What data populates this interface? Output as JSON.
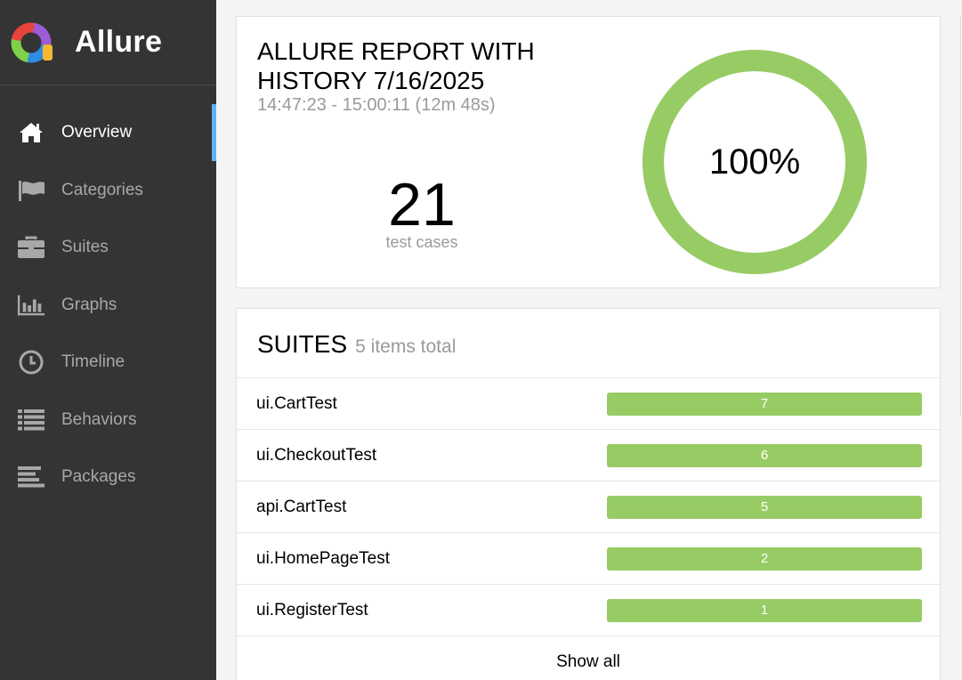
{
  "app": {
    "name": "Allure",
    "logo_icon": "allure-logo-icon"
  },
  "sidebar": {
    "items": [
      {
        "label": "Overview",
        "icon": "home-icon",
        "active": true
      },
      {
        "label": "Categories",
        "icon": "flag-icon",
        "active": false
      },
      {
        "label": "Suites",
        "icon": "briefcase-icon",
        "active": false
      },
      {
        "label": "Graphs",
        "icon": "bar-chart-icon",
        "active": false
      },
      {
        "label": "Timeline",
        "icon": "clock-icon",
        "active": false
      },
      {
        "label": "Behaviors",
        "icon": "list-icon",
        "active": false
      },
      {
        "label": "Packages",
        "icon": "align-left-icon",
        "active": false
      }
    ]
  },
  "summary": {
    "title": "ALLURE REPORT WITH HISTORY 7/16/2025",
    "time_range": "14:47:23 - 15:00:11 (12m 48s)",
    "test_count": "21",
    "test_count_label": "test cases",
    "pass_percent_label": "100%",
    "pass_fraction": 1.0
  },
  "suites": {
    "title": "SUITES",
    "total_label": "5 items total",
    "rows": [
      {
        "name": "ui.CartTest",
        "count": "7"
      },
      {
        "name": "ui.CheckoutTest",
        "count": "6"
      },
      {
        "name": "api.CartTest",
        "count": "5"
      },
      {
        "name": "ui.HomePageTest",
        "count": "2"
      },
      {
        "name": "ui.RegisterTest",
        "count": "1"
      }
    ],
    "show_all_label": "Show all"
  },
  "colors": {
    "sidebar_bg": "#343434",
    "passed": "#97cc64",
    "active_indicator": "#5bb3f0"
  }
}
